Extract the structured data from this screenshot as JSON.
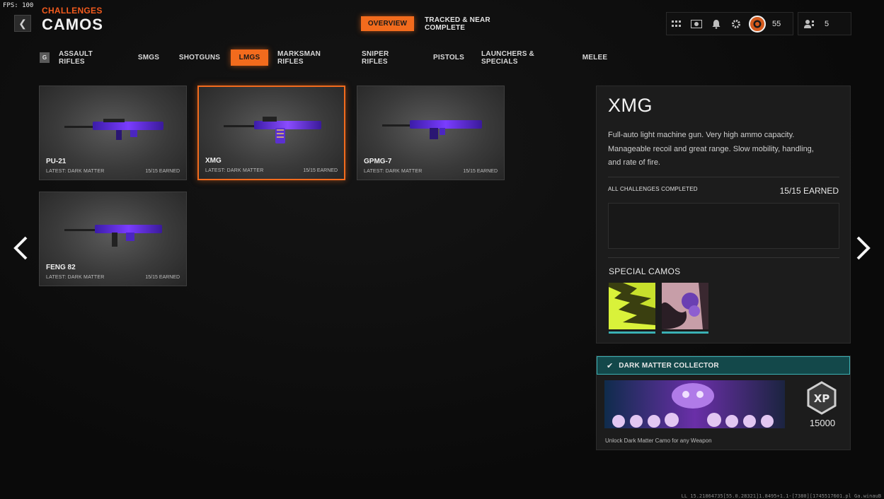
{
  "fps": "FPS: 100",
  "header": {
    "back_icon": "chevron-left-icon",
    "subtitle": "CHALLENGES",
    "title": "CAMOS"
  },
  "top_tabs": [
    {
      "label": "OVERVIEW",
      "active": true
    },
    {
      "label": "TRACKED & NEAR COMPLETE",
      "active": false
    }
  ],
  "top_bar": {
    "icons": [
      "grid-icon",
      "battlepass-icon",
      "bell-icon",
      "gear-icon"
    ],
    "rank_icon": "rank-badge-icon",
    "level": "55",
    "party_icon": "party-icon",
    "party_count": "5"
  },
  "categories": {
    "key_hint": "G",
    "items": [
      {
        "label": "ASSAULT RIFLES"
      },
      {
        "label": "SMGS"
      },
      {
        "label": "SHOTGUNS"
      },
      {
        "label": "LMGS"
      },
      {
        "label": "MARKSMAN RIFLES"
      },
      {
        "label": "SNIPER RIFLES"
      },
      {
        "label": "PISTOLS"
      },
      {
        "label": "LAUNCHERS & SPECIALS"
      },
      {
        "label": "MELEE"
      }
    ],
    "active": "LMGS"
  },
  "weapons": [
    {
      "name": "PU-21",
      "latest": "LATEST: DARK MATTER",
      "earned": "15/15 EARNED"
    },
    {
      "name": "XMG",
      "latest": "LATEST: DARK MATTER",
      "earned": "15/15 EARNED"
    },
    {
      "name": "GPMG-7",
      "latest": "LATEST: DARK MATTER",
      "earned": "15/15 EARNED"
    },
    {
      "name": "FENG 82",
      "latest": "LATEST: DARK MATTER",
      "earned": "15/15 EARNED"
    }
  ],
  "nav": {
    "prev_icon": "arrow-left-icon",
    "next_icon": "arrow-right-icon"
  },
  "detail": {
    "title": "XMG",
    "description": "Full-auto light machine gun.  Very high ammo capacity. Manageable recoil and great range. Slow mobility, handling, and rate of fire.",
    "challenge_label": "ALL CHALLENGES COMPLETED",
    "challenge_earned": "15/15 EARNED",
    "special_camos_label": "SPECIAL CAMOS"
  },
  "reward": {
    "check_icon": "check-icon",
    "title": "DARK MATTER COLLECTOR",
    "xp_icon": "xp-icon",
    "xp_amount": "15000",
    "description": "Unlock Dark Matter Camo for any Weapon"
  },
  "debug_text": "LL 15.21864735[55.0.28321]1.8495+1.1-[7380][1745517601.pl Ga.winauB"
}
